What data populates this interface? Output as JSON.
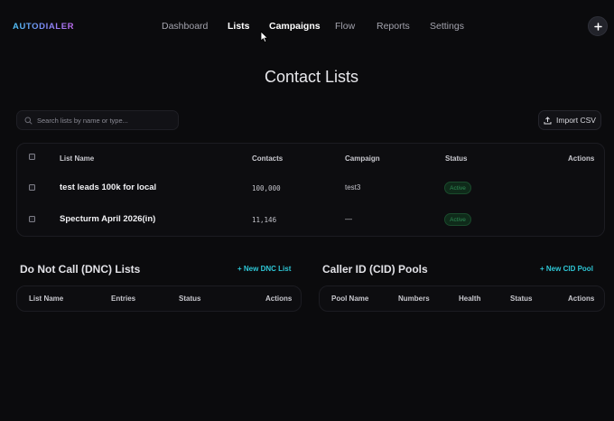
{
  "brand": "AUTODIALER",
  "nav": {
    "items": [
      {
        "label": "Dashboard",
        "state": "normal"
      },
      {
        "label": "Lists",
        "state": "active"
      },
      {
        "label": "Campaigns",
        "state": "hover"
      },
      {
        "label": "Flow",
        "state": "normal"
      },
      {
        "label": "Reports",
        "state": "normal"
      },
      {
        "label": "Settings",
        "state": "normal"
      }
    ],
    "add_button": "+"
  },
  "page_title": "Contact Lists",
  "search": {
    "placeholder": "Search lists by name or type..."
  },
  "import_button": "Import CSV",
  "contact_lists": {
    "columns": [
      "List Name",
      "Contacts",
      "Campaign",
      "Status",
      "Actions"
    ],
    "rows": [
      {
        "name": "test leads 100k for local",
        "contacts": "100,000",
        "campaign": "test3",
        "status": "Active"
      },
      {
        "name": "Specturm April 2026(in)",
        "contacts": "11,146",
        "campaign": "—",
        "status": "Active"
      }
    ]
  },
  "dnc": {
    "title": "Do Not Call (DNC) Lists",
    "new_label": "New DNC List",
    "columns": [
      "List Name",
      "Entries",
      "Status",
      "Actions"
    ]
  },
  "cid": {
    "title": "Caller ID (CID) Pools",
    "new_label": "New CID Pool",
    "columns": [
      "Pool Name",
      "Numbers",
      "Health",
      "Status",
      "Actions"
    ]
  },
  "colors": {
    "accent": "#2ec7d6",
    "status_active": "#2e8c54",
    "background": "#0b0b0d"
  }
}
